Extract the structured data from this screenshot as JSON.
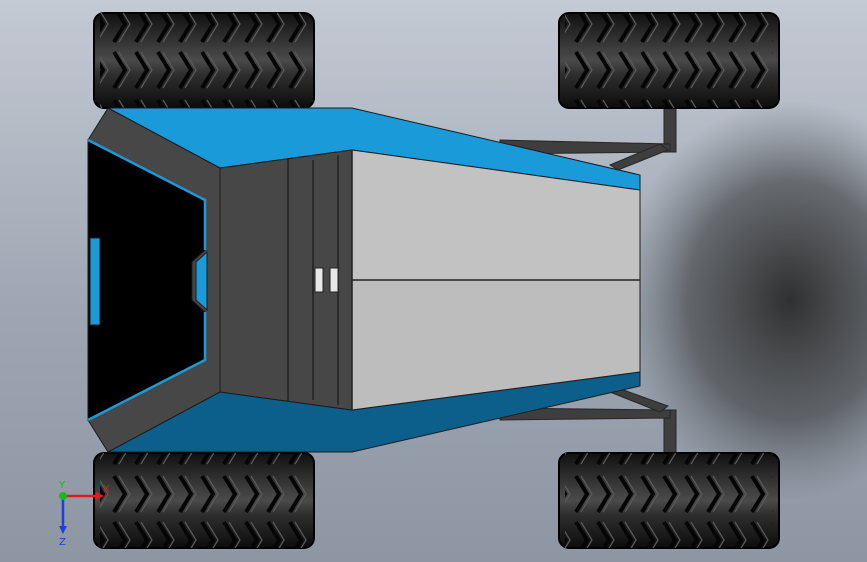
{
  "viewport": {
    "background_top": "#c3cad4",
    "background_bottom": "#8d96a2"
  },
  "model": {
    "body_color": "#1a9ad8",
    "body_shade_color": "#0c5f8a",
    "cover_color": "#c2c2c2",
    "frame_color": "#474747",
    "cockpit_color": "#000000",
    "tire_color": "#1e1e1e",
    "wheels": [
      "wheel-front-left",
      "wheel-rear-left",
      "wheel-front-right",
      "wheel-rear-right"
    ]
  },
  "triad": {
    "x_label": "X",
    "y_label": "Y",
    "z_label": "Z",
    "x_color": "#e11a1a",
    "y_color": "#1fb51f",
    "z_color": "#1f3fd8"
  }
}
